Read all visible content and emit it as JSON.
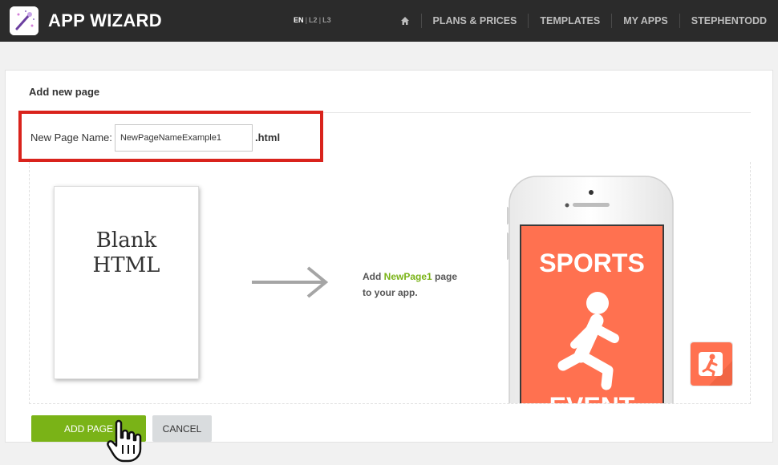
{
  "header": {
    "brand": "APP WIZARD",
    "languages": [
      {
        "label": "EN",
        "active": true
      },
      {
        "label": "L2",
        "active": false
      },
      {
        "label": "L3",
        "active": false
      }
    ],
    "nav": [
      "PLANS & PRICES",
      "TEMPLATES",
      "MY APPS",
      "STEPHENTODD"
    ]
  },
  "panel": {
    "title": "Add new page",
    "name_label": "New Page Name:",
    "name_value": "NewPageNameExample1",
    "name_extension": ".html",
    "blank_card_text": "Blank\nHTML",
    "add_text_prefix": "Add ",
    "add_text_page": "NewPage1",
    "add_text_suffix": " page to your app.",
    "phone_screen_title": "SPORTS",
    "phone_screen_subtitle": "EVENT",
    "screen_color": "#ff7150",
    "accent_color": "#7ab317",
    "highlight_border_color": "#d9231c"
  },
  "actions": {
    "add_label": "ADD PAGE",
    "cancel_label": "CANCEL"
  },
  "icons": [
    "magic-wand-icon",
    "home-icon",
    "arrow-right-icon",
    "running-person-icon",
    "hand-pointer-icon"
  ]
}
